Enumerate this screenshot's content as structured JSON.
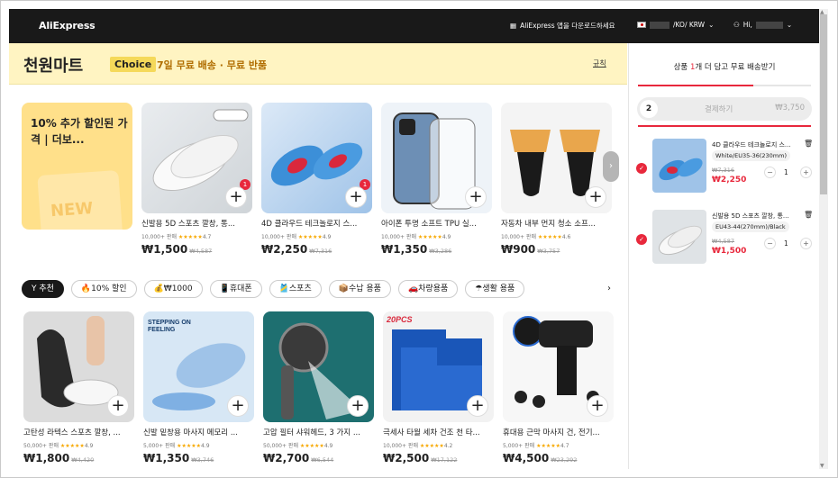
{
  "topbar": {
    "logo": "AliExpress",
    "app_download": "AliExpress 앱을 다운로드하세요",
    "locale": "/KO/ KRW",
    "user": "Hi,"
  },
  "banner": {
    "title": "천원마트",
    "choice": "Choice",
    "subtitle": "7일 무료 배송 · 무료 반품",
    "rules": "규칙"
  },
  "promo": {
    "text": "10% 추가 할인된 가격 | 더보...",
    "watermark": "NEW"
  },
  "top_products": [
    {
      "title": "신발용 5D 스포츠 깔창, 통...",
      "sold": "10,000+ 판매",
      "rating": "4.7",
      "price": "₩1,500",
      "old_price": "₩4,587",
      "badge": "1"
    },
    {
      "title": "4D 클라우드 테크놀로지 스...",
      "sold": "10,000+ 판매",
      "rating": "4.9",
      "price": "₩2,250",
      "old_price": "₩7,316",
      "badge": "1"
    },
    {
      "title": "아이폰 투명 소프트 TPU 실...",
      "sold": "10,000+ 판매",
      "rating": "4.9",
      "price": "₩1,350",
      "old_price": "₩3,286",
      "badge": ""
    },
    {
      "title": "자동차 내부 먼지 청소 소프...",
      "sold": "10,000+ 판매",
      "rating": "4.6",
      "price": "₩900",
      "old_price": "₩3,757",
      "badge": ""
    }
  ],
  "tabs": [
    "추천",
    "10% 할인",
    "₩1000",
    "휴대폰",
    "스포츠",
    "수납 용품",
    "차량용품",
    "생활 용품"
  ],
  "bottom_products": [
    {
      "title": "고탄성 라텍스 스포츠 깔창, ...",
      "sold": "50,000+ 판매",
      "rating": "4.9",
      "price": "₩1,800",
      "old_price": "₩4,420"
    },
    {
      "title": "신발 밑창용 마사지 메모리 ...",
      "sold": "5,000+ 판매",
      "rating": "4.9",
      "price": "₩1,350",
      "old_price": "₩3,746"
    },
    {
      "title": "고압 필터 샤워헤드, 3 가지 ...",
      "sold": "50,000+ 판매",
      "rating": "4.9",
      "price": "₩2,700",
      "old_price": "₩6,544"
    },
    {
      "title": "극세사 타월 세차 건조 천 타...",
      "sold": "10,000+ 판매",
      "rating": "4.2",
      "price": "₩2,500",
      "old_price": "₩17,122"
    },
    {
      "title": "휴대용 근막 마사지 건, 전기...",
      "sold": "5,000+ 판매",
      "rating": "4.7",
      "price": "₩4,500",
      "old_price": "₩23,292"
    }
  ],
  "cart": {
    "header_pre": "상품 ",
    "header_num": "1",
    "header_post": "개 더 담고 무료 배송받기",
    "count": "2",
    "pay_label": "결제하기",
    "total": "₩3,750",
    "items": [
      {
        "title": "4D 클라우드 테크놀로지 스...",
        "sku": "White/EU35-36(230mm)",
        "old_price": "₩7,316",
        "price": "₩2,250",
        "qty": "1"
      },
      {
        "title": "신발용 5D 스포츠 깔창, 통...",
        "sku": "EU43-44(270mm)/Black",
        "old_price": "₩4,587",
        "price": "₩1,500",
        "qty": "1"
      }
    ]
  },
  "colors": {
    "accent": "#e8283c",
    "banner_bg": "#fff4c2",
    "topbar": "#191919"
  }
}
